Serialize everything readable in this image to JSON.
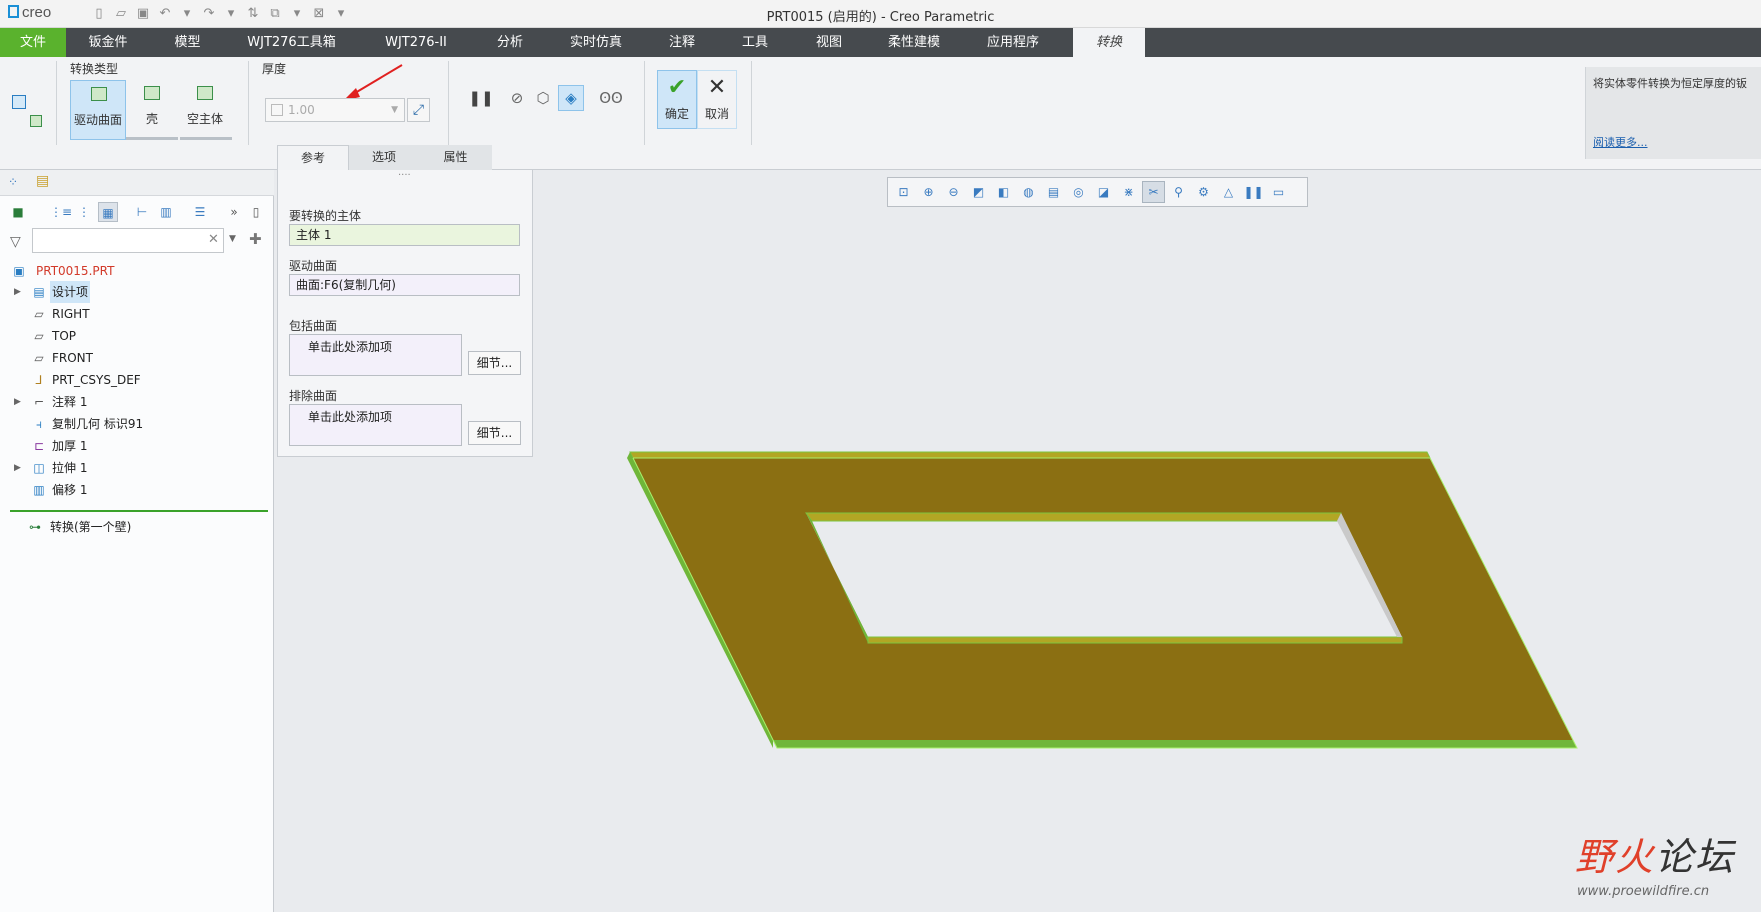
{
  "app": {
    "logo_text": "creo",
    "window_title": "PRT0015 (启用的) - Creo Parametric"
  },
  "ribbon_tabs": [
    {
      "label": "文件"
    },
    {
      "label": "钣金件"
    },
    {
      "label": "模型"
    },
    {
      "label": "WJT276工具箱"
    },
    {
      "label": "WJT276-II"
    },
    {
      "label": "分析"
    },
    {
      "label": "实时仿真"
    },
    {
      "label": "注释"
    },
    {
      "label": "工具"
    },
    {
      "label": "视图"
    },
    {
      "label": "柔性建模"
    },
    {
      "label": "应用程序"
    },
    {
      "label": "转换"
    }
  ],
  "ribbon": {
    "type_group_label": "转换类型",
    "type_buttons": [
      {
        "label": "驱动曲面",
        "selected": true
      },
      {
        "label": "壳",
        "selected": false
      },
      {
        "label": "空主体",
        "selected": false
      }
    ],
    "thickness_label": "厚度",
    "thickness_value": "1.00",
    "ok_label": "确定",
    "cancel_label": "取消",
    "help_text": "将实体零件转换为恒定厚度的钣",
    "help_link": "阅读更多..."
  },
  "dashboard_tabs": [
    {
      "label": "参考",
      "active": true
    },
    {
      "label": "选项",
      "active": false
    },
    {
      "label": "属性",
      "active": false
    }
  ],
  "references": {
    "body_label": "要转换的主体",
    "body_value": "主体 1",
    "driving_label": "驱动曲面",
    "driving_value": "曲面:F6(复制几何)",
    "include_label": "包括曲面",
    "include_placeholder": "单击此处添加项",
    "include_btn": "细节...",
    "exclude_label": "排除曲面",
    "exclude_placeholder": "单击此处添加项",
    "exclude_btn": "细节..."
  },
  "model_tree": {
    "root": "PRT0015.PRT",
    "items": [
      {
        "label": "设计项"
      },
      {
        "label": "RIGHT"
      },
      {
        "label": "TOP"
      },
      {
        "label": "FRONT"
      },
      {
        "label": "PRT_CSYS_DEF"
      },
      {
        "label": "注释 1"
      },
      {
        "label": "复制几何 标识91"
      },
      {
        "label": "加厚 1"
      },
      {
        "label": "拉伸 1"
      },
      {
        "label": "偏移 1"
      }
    ],
    "inserting": "转换(第一个壁)"
  },
  "watermark": {
    "main_red": "野火",
    "main_dark": "论坛",
    "url": "www.proewildfire.cn"
  },
  "colors": {
    "file_tab": "#5ab22d",
    "tab_bar": "#464a4e",
    "model_top": "#8b6f12",
    "model_edge": "#7cc43e",
    "root_red": "#d23a2a"
  }
}
